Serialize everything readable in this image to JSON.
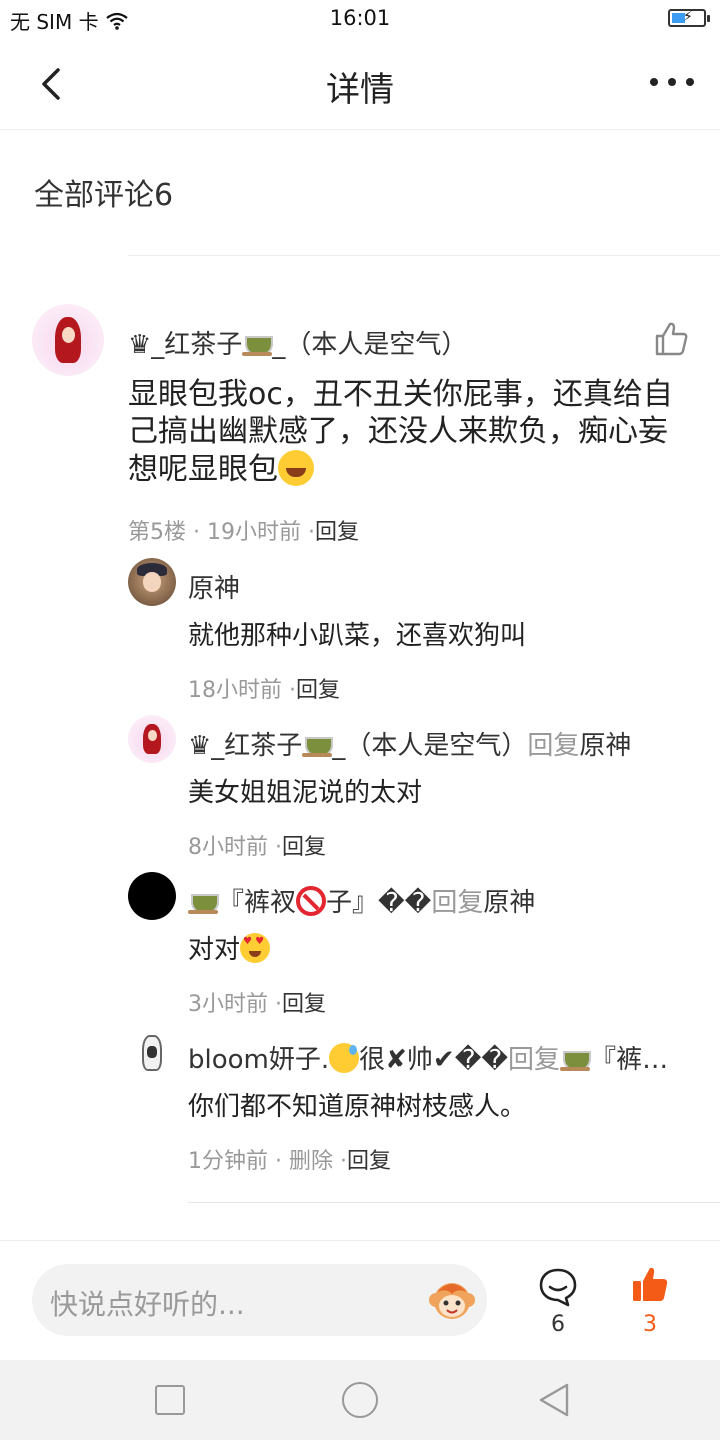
{
  "status": {
    "carrier": "无 SIM 卡",
    "time": "16:01"
  },
  "nav": {
    "title": "详情"
  },
  "section": {
    "title": "全部评论6"
  },
  "main_comment": {
    "name_prefix": "♛_红茶子",
    "name_suffix": "_（本人是空气）",
    "body": "显眼包我oc，丑不丑关你屁事，还真给自己搞出幽默感了，还没人来欺负，痴心妄想呢显眼包",
    "floor_time": "第5楼 · 19小时前 ·",
    "reply_action": "回复"
  },
  "replies": [
    {
      "name": "原神",
      "body": "就他那种小趴菜，还喜欢狗叫",
      "time": "18小时前 ·",
      "action": "回复"
    },
    {
      "name_prefix": "♛_红茶子",
      "name_suffix": "_（本人是空气）",
      "reply_word": "回复",
      "target": "原神",
      "body": "美女姐姐泥说的太对",
      "time": "8小时前 ·",
      "action": "回复"
    },
    {
      "name_prefix": "『裤衩",
      "name_suffix": "子』��",
      "reply_word": "回复",
      "target": "原神",
      "body": "对对",
      "time": "3小时前 ·",
      "action": "回复"
    },
    {
      "name_prefix": "bloom妍子.",
      "name_mid": "很✘帅✔��",
      "reply_word": "回复",
      "target": "『裤…",
      "body": "你们都不知道原神树枝感人。",
      "time": "1分钟前 · 删除 ·",
      "action": "回复"
    }
  ],
  "bottom": {
    "input_placeholder": "快说点好听的...",
    "comment_count": "6",
    "like_count": "3",
    "like_color": "#f35b17"
  },
  "icons": [
    "back-arrow-icon",
    "more-dots-icon",
    "thumbs-up-outline-icon",
    "monkey-emoji-icon",
    "comment-bubble-icon",
    "thumbs-up-filled-icon",
    "recent-apps-icon",
    "home-icon",
    "back-triangle-icon"
  ]
}
